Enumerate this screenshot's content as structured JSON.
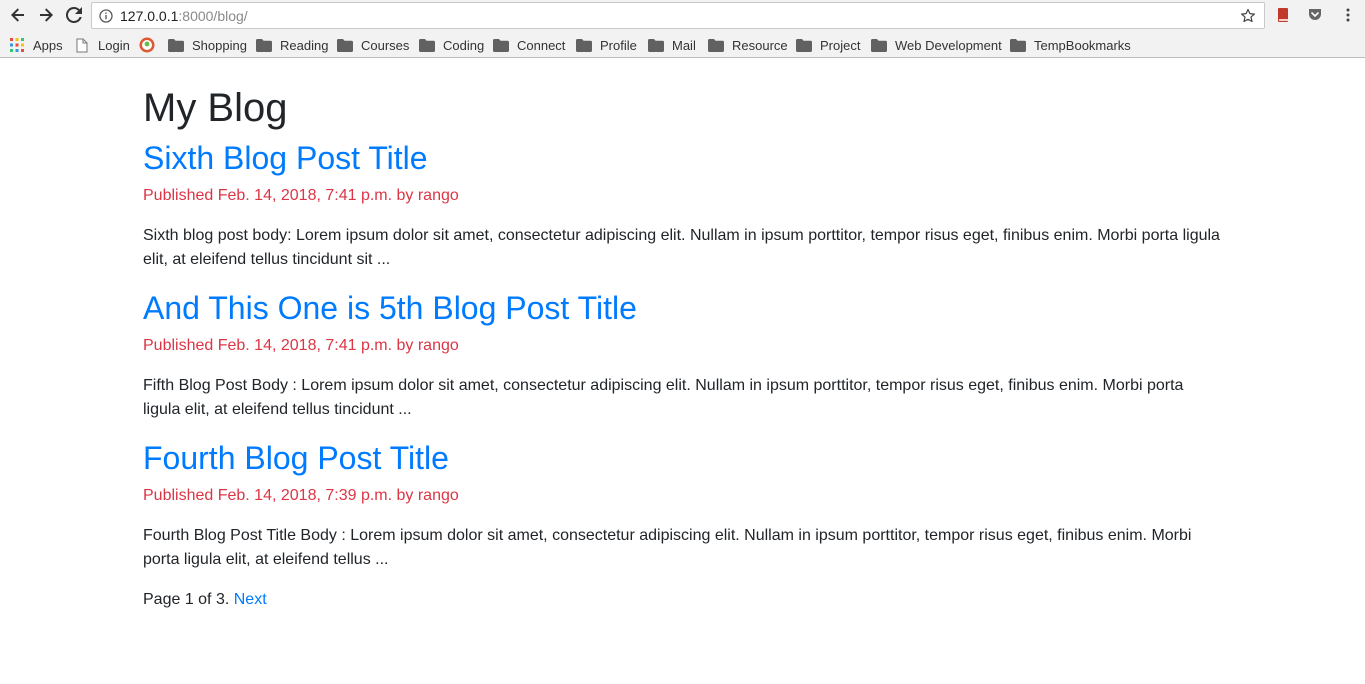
{
  "browser": {
    "url_host": "127.0.0.1",
    "url_path": ":8000/blog/",
    "bookmarks": [
      {
        "label": "Apps",
        "icon": "apps-grid-icon"
      },
      {
        "label": "Login",
        "icon": "page-icon"
      },
      {
        "label": "",
        "icon": "duckduckgo-icon"
      },
      {
        "label": "Shopping",
        "icon": "folder-icon"
      },
      {
        "label": "Reading",
        "icon": "folder-icon"
      },
      {
        "label": "Courses",
        "icon": "folder-icon"
      },
      {
        "label": "Coding",
        "icon": "folder-icon"
      },
      {
        "label": "Connect",
        "icon": "folder-icon"
      },
      {
        "label": "Profile",
        "icon": "folder-icon"
      },
      {
        "label": "Mail",
        "icon": "folder-icon"
      },
      {
        "label": "Resource",
        "icon": "folder-icon"
      },
      {
        "label": "Project",
        "icon": "folder-icon"
      },
      {
        "label": "Web Development",
        "icon": "folder-icon"
      },
      {
        "label": "TempBookmarks",
        "icon": "folder-icon"
      }
    ]
  },
  "colors": {
    "link": "#007bff",
    "meta": "#dc3545",
    "text": "#212529"
  },
  "page": {
    "title": "My Blog",
    "posts": [
      {
        "title": "Sixth Blog Post Title",
        "meta": "Published Feb. 14, 2018, 7:41 p.m. by rango",
        "body": "Sixth blog post body: Lorem ipsum dolor sit amet, consectetur adipiscing elit. Nullam in ipsum porttitor, tempor risus eget, finibus enim. Morbi porta ligula elit, at eleifend tellus tincidunt sit ..."
      },
      {
        "title": "And This One is 5th Blog Post Title",
        "meta": "Published Feb. 14, 2018, 7:41 p.m. by rango",
        "body": "Fifth Blog Post Body : Lorem ipsum dolor sit amet, consectetur adipiscing elit. Nullam in ipsum porttitor, tempor risus eget, finibus enim. Morbi porta ligula elit, at eleifend tellus tincidunt ..."
      },
      {
        "title": "Fourth Blog Post Title",
        "meta": "Published Feb. 14, 2018, 7:39 p.m. by rango",
        "body": "Fourth Blog Post Title Body : Lorem ipsum dolor sit amet, consectetur adipiscing elit. Nullam in ipsum porttitor, tempor risus eget, finibus enim. Morbi porta ligula elit, at eleifend tellus ..."
      }
    ],
    "pagination": {
      "status": "Page 1 of 3.",
      "next_label": "Next"
    }
  }
}
